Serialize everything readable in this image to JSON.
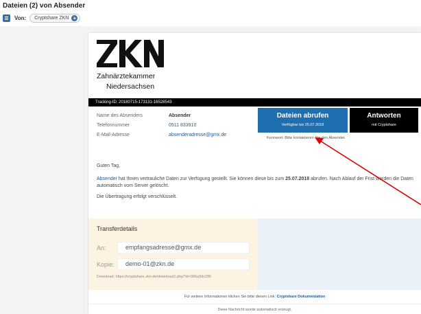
{
  "mail": {
    "title": "Dateien (2) von Absender",
    "from_label": "Von:",
    "from_name": "Cryptshare ZKN"
  },
  "logo": {
    "mark": "ZKN",
    "line1": "Zahnärztekammer",
    "line2": "Niedersachsen"
  },
  "tracking": {
    "text": "Tracking-ID: 20180715-173131-16528543"
  },
  "sender": {
    "name_label": "Name des Absenders",
    "name_value": "Absender",
    "phone_label": "Telefonnummer",
    "phone_value": "0511 833910",
    "email_label": "E-Mail-Adresse",
    "email_value": "absenderadresse@gmx.de"
  },
  "actions": {
    "download_label": "Dateien abrufen",
    "download_sub": "Verfügbar bis 25.07.2018",
    "reply_label": "Antworten",
    "reply_sub": "mit Cryptshare",
    "password_hint": "Kennwort: Bitte kontaktieren Sie den Absender."
  },
  "message": {
    "greeting": "Guten Tag,",
    "sender_link": "Absender",
    "text_part1": " hat Ihnen vertrauliche Daten zur Verfügung gestellt. Sie können diese bis zum ",
    "date": "25.07.2018",
    "text_part2": " abrufen. Nach Ablauf der Frist werden die Daten automatisch vom Server gelöscht.",
    "encrypted": "Die Übertragung erfolgt verschlüsselt."
  },
  "transfer": {
    "title": "Transferdetails",
    "to_label": "An:",
    "to_value": "empfangsadresse@gmx.de",
    "cc_label": "Kopie:",
    "cc_value": "demo-01@zkn.de",
    "download_link": "Download: https://cryptshare.zkn.de/download1.php?id=386a3dc286"
  },
  "footer": {
    "info_text": "Für weitere Informationen klicken Sie bitte diesen Link: ",
    "info_link": "Cryptshare Dokumentation",
    "auto": "Diese Nachricht wurde automatisch erzeugt."
  },
  "colors": {
    "brand_blue": "#1f6fb0",
    "reply_black": "#000000",
    "transfer_bg": "#fdf3e3",
    "annotation_red": "#e00000"
  }
}
